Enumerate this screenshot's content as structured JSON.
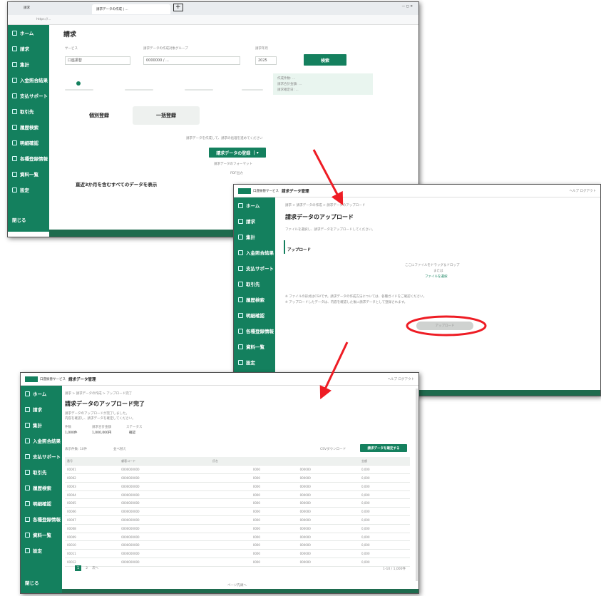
{
  "screen1": {
    "browser": {
      "tab1_label": "請求",
      "tab2_label": "請求データの作成 | ...",
      "new_tab_label": "+",
      "url": "https://..."
    },
    "sidebar": [
      {
        "label": "ホーム",
        "icon": "home-icon"
      },
      {
        "label": "請求",
        "icon": "invoice-icon"
      },
      {
        "label": "集計",
        "icon": "chart-icon"
      },
      {
        "label": "入金照合結果",
        "icon": "check-icon"
      },
      {
        "label": "支払サポート",
        "icon": "support-icon"
      },
      {
        "label": "取引先",
        "icon": "partner-icon"
      },
      {
        "label": "履歴検索",
        "icon": "history-icon"
      },
      {
        "label": "明細確認",
        "icon": "detail-icon"
      },
      {
        "label": "各種登録情報",
        "icon": "info-icon"
      },
      {
        "label": "資料一覧",
        "icon": "docs-icon"
      },
      {
        "label": "設定",
        "icon": "gear-icon"
      }
    ],
    "sidebar_footer": "閉じる",
    "page_title": "請求",
    "form": {
      "label1": "サービス",
      "value1": "口座振替",
      "label2": "請求データの作成対象グループ",
      "value2": "0000000 / ...",
      "label3": "請求年月",
      "value3": "2025",
      "search_label": "検索"
    },
    "steps": [
      "作成中",
      "",
      "",
      ""
    ],
    "info_box": [
      "作成件数: ...",
      "請求合計金額: ...",
      "請求確定日: ..."
    ],
    "tabs": {
      "left": "個別登録",
      "right": "一括登録"
    },
    "upload_hint": "請求データを作成して、請求の処理を進めてください",
    "upload_button": "請求データの登録",
    "upload_sub": "請求データのフォーマット",
    "upload_sub2": "PDF出力",
    "list_heading": "直近3か月を含むすべてのデータを表示"
  },
  "screen2": {
    "header_brand": "口座振替サービス",
    "header_app": "請求データ管理",
    "header_right": "ヘルプ  ログアウト",
    "breadcrumb": "請求 > 請求データの作成 > 請求データのアップロード",
    "sidebar": [
      {
        "label": "ホーム",
        "icon": "home-icon"
      },
      {
        "label": "請求",
        "icon": "invoice-icon"
      },
      {
        "label": "集計",
        "icon": "chart-icon"
      },
      {
        "label": "入金照合結果",
        "icon": "check-icon"
      },
      {
        "label": "支払サポート",
        "icon": "support-icon"
      },
      {
        "label": "取引先",
        "icon": "partner-icon"
      },
      {
        "label": "履歴検索",
        "icon": "history-icon"
      },
      {
        "label": "明細確認",
        "icon": "detail-icon"
      },
      {
        "label": "各種登録情報",
        "icon": "info-icon"
      },
      {
        "label": "資料一覧",
        "icon": "docs-icon"
      },
      {
        "label": "設定",
        "icon": "gear-icon"
      }
    ],
    "page_title": "請求データのアップロード",
    "subtitle": "ファイルを選択し、請求データをアップロードしてください。",
    "section": "アップロード",
    "drop_line1": "ここにファイルをドラッグ＆ドロップ",
    "drop_line2": "または",
    "drop_link": "ファイルを選択",
    "note1": "※ ファイルの形式はCSVです。請求データの作成方法については、各種ガイドをご確認ください。",
    "note2": "※ アップロードしたデータは、内容を確認した後に請求データとして登録されます。",
    "upload_button": "アップロード"
  },
  "screen3": {
    "header_brand": "口座振替サービス",
    "header_app": "請求データ管理",
    "header_right": "ヘルプ  ログアウト",
    "breadcrumb": "請求 > 請求データの作成 > アップロード完了",
    "sidebar": [
      {
        "label": "ホーム",
        "icon": "home-icon"
      },
      {
        "label": "請求",
        "icon": "invoice-icon"
      },
      {
        "label": "集計",
        "icon": "chart-icon"
      },
      {
        "label": "入金照合結果",
        "icon": "check-icon"
      },
      {
        "label": "支払サポート",
        "icon": "support-icon"
      },
      {
        "label": "取引先",
        "icon": "partner-icon"
      },
      {
        "label": "履歴検索",
        "icon": "history-icon"
      },
      {
        "label": "明細確認",
        "icon": "detail-icon"
      },
      {
        "label": "各種登録情報",
        "icon": "info-icon"
      },
      {
        "label": "資料一覧",
        "icon": "docs-icon"
      },
      {
        "label": "設定",
        "icon": "gear-icon"
      }
    ],
    "sidebar_footer": "閉じる",
    "page_title": "請求データのアップロード完了",
    "message1": "請求データのアップロードが完了しました。",
    "message2": "内容を確認し、請求データを確定してください。",
    "summary_labels": [
      "件数",
      "請求合計金額",
      "ステータス"
    ],
    "summary_values": [
      "1,000件",
      "1,000,000円",
      "確認"
    ],
    "filter_label": "表示件数: 10件",
    "filter_label2": "並べ替え",
    "link_right": "CSVダウンロード",
    "confirm_button": "請求データを確定する",
    "table_headers": [
      "番号",
      "顧客コード",
      "氏名",
      "",
      "",
      "金額"
    ],
    "table_rows": [
      [
        "00001",
        "0000000000",
        "",
        "0000",
        "000000",
        "0,000"
      ],
      [
        "00002",
        "0000000000",
        "",
        "0000",
        "000000",
        "0,000"
      ],
      [
        "00003",
        "0000000000",
        "",
        "0000",
        "000000",
        "0,000"
      ],
      [
        "00004",
        "0000000000",
        "",
        "0000",
        "000000",
        "0,000"
      ],
      [
        "00005",
        "0000000000",
        "",
        "0000",
        "000000",
        "0,000"
      ],
      [
        "00006",
        "0000000000",
        "",
        "0000",
        "000000",
        "0,000"
      ],
      [
        "00007",
        "0000000000",
        "",
        "0000",
        "000000",
        "0,000"
      ],
      [
        "00008",
        "0000000000",
        "",
        "0000",
        "000000",
        "0,000"
      ],
      [
        "00009",
        "0000000000",
        "",
        "0000",
        "000000",
        "0,000"
      ],
      [
        "00010",
        "0000000000",
        "",
        "0000",
        "000000",
        "0,000"
      ],
      [
        "00011",
        "0000000000",
        "",
        "0000",
        "000000",
        "0,000"
      ],
      [
        "00012",
        "0000000000",
        "",
        "0000",
        "000000",
        "0,000"
      ]
    ],
    "pagination": [
      "1",
      "2",
      "次へ"
    ],
    "pagination_right": "1-10 / 1,000件",
    "footer_link": "ページ先頭へ"
  },
  "annotation": {
    "color": "#ee1c24"
  }
}
